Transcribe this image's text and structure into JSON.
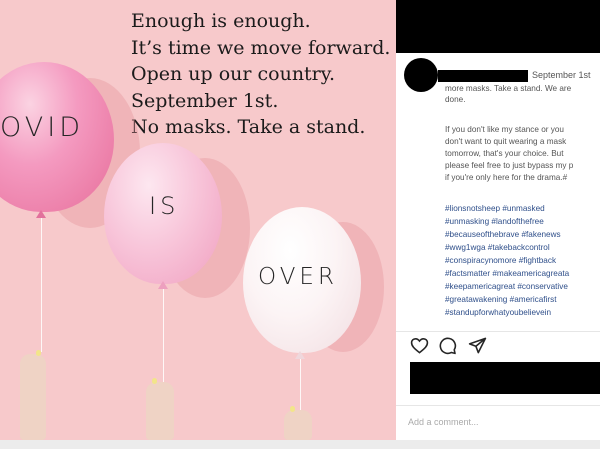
{
  "post": {
    "headline_lines": [
      "Enough is enough.",
      "It’s time we move forward.",
      "Open up our country.",
      "September 1st.",
      "No masks. Take a stand."
    ],
    "balloon_words": [
      "OVID",
      "IS",
      "OVER"
    ],
    "colors": {
      "background": "#f7c9cb",
      "balloon_pink": "#f08fb0",
      "balloon_light_pink": "#f6b9d0",
      "balloon_white": "#fbf2f3"
    }
  },
  "sidebar": {
    "date": "September 1st",
    "caption_lines": [
      "more masks. Take a stand. We are",
      "done.",
      "",
      "If you don't like my stance or you",
      "don't want to quit wearing a mask",
      "tomorrow, that's your choice. But",
      "please feel free to just bypass my p",
      "if you're only here for the drama.#"
    ],
    "hashtag_lines": [
      "#lionsnotsheep #unmasked",
      "#unmasking #landofthefree",
      "#becauseofthebrave #fakenews",
      "#wwg1wga #takebackcontrol",
      "#conspiracynomore #fightback",
      "#factsmatter #makeamericagreata",
      "#keepamericagreat #conservative",
      "#greatawakening #americafirst",
      "#standupforwhatyoubelievein"
    ],
    "icons": [
      "heart-icon",
      "comment-icon",
      "share-icon"
    ],
    "comment_placeholder": "Add a comment..."
  }
}
